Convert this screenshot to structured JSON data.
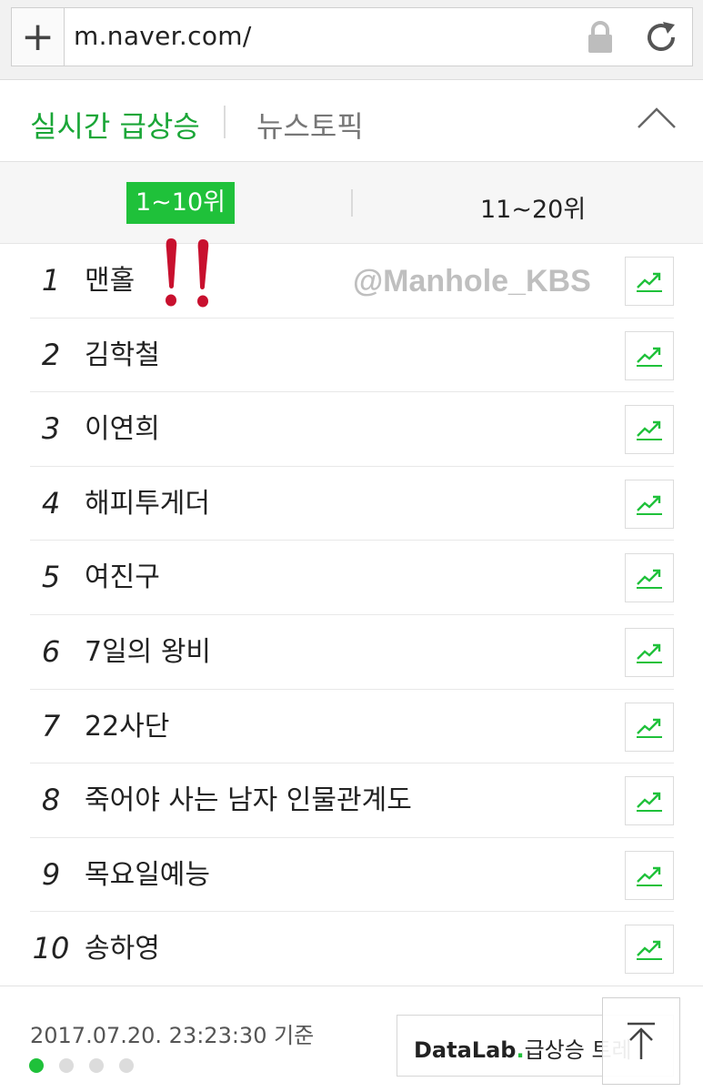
{
  "browser": {
    "new_tab_symbol": "+",
    "url": "m.naver.com/",
    "lock_icon": "lock-icon",
    "reload_icon": "reload-icon"
  },
  "tabs": {
    "realtime": "실시간 급상승",
    "news": "뉴스토픽",
    "active": "realtime",
    "collapse_icon": "chevron-up-icon"
  },
  "range": {
    "first": "1~10위",
    "second": "11~20위",
    "active": "first"
  },
  "annotation": {
    "watermark": "@Manhole_KBS"
  },
  "ranking": [
    {
      "rank": "1",
      "keyword": "맨홀"
    },
    {
      "rank": "2",
      "keyword": "김학철"
    },
    {
      "rank": "3",
      "keyword": "이연희"
    },
    {
      "rank": "4",
      "keyword": "해피투게더"
    },
    {
      "rank": "5",
      "keyword": "여진구"
    },
    {
      "rank": "6",
      "keyword": "7일의 왕비"
    },
    {
      "rank": "7",
      "keyword": "22사단"
    },
    {
      "rank": "8",
      "keyword": "죽어야 사는 남자 인물관계도"
    },
    {
      "rank": "9",
      "keyword": "목요일예능"
    },
    {
      "rank": "10",
      "keyword": "송하영"
    }
  ],
  "footer": {
    "timestamp": "2017.07.20. 23:23:30 기준",
    "page_dots_total": 4,
    "page_dots_active": 1,
    "datalab_brand": "DataLab",
    "datalab_dot": ".",
    "datalab_label": "급상승 트레",
    "scroll_top_icon": "arrow-up-icon"
  },
  "colors": {
    "accent_green": "#1fc13a",
    "tab_active_green": "#1aa637",
    "annotation_red": "#c8102e"
  }
}
